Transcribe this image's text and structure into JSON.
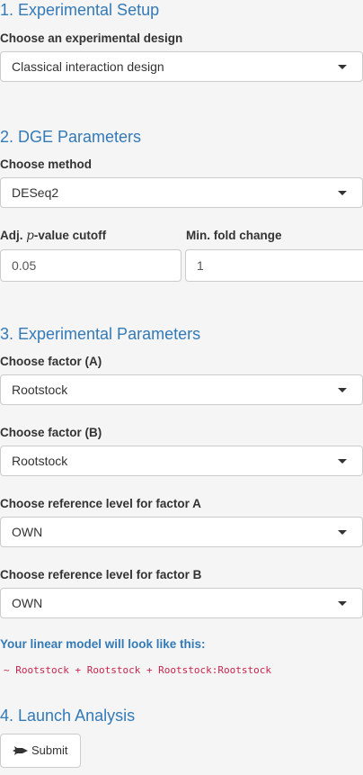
{
  "sections": {
    "setup_title": "1. Experimental Setup",
    "dge_title": "2. DGE Parameters",
    "exp_title": "3. Experimental Parameters",
    "launch_title": "4. Launch Analysis"
  },
  "setup": {
    "design_label": "Choose an experimental design",
    "design_value": "Classical interaction design"
  },
  "dge": {
    "method_label": "Choose method",
    "method_value": "DESeq2",
    "pvalue_label_pre": "Adj. ",
    "pvalue_label_p": "p",
    "pvalue_label_post": "-value cutoff",
    "pvalue_value": "0.05",
    "fold_label": "Min. fold change",
    "fold_value": "1"
  },
  "exp": {
    "factor_a_label": "Choose factor (A)",
    "factor_a_value": "Rootstock",
    "factor_b_label": "Choose factor (B)",
    "factor_b_value": "Rootstock",
    "ref_a_label": "Choose reference level for factor A",
    "ref_a_value": "OWN",
    "ref_b_label": "Choose reference level for factor B",
    "ref_b_value": "OWN"
  },
  "model": {
    "title": "Your linear model will look like this:",
    "formula": "~ Rootstock + Rootstock + Rootstock:Rootstock"
  },
  "launch": {
    "submit_label": "Submit",
    "submit_icon": "rocket-icon"
  },
  "colors": {
    "heading": "#337ab7",
    "formula": "#c7254e",
    "background": "#f5f5f5"
  }
}
